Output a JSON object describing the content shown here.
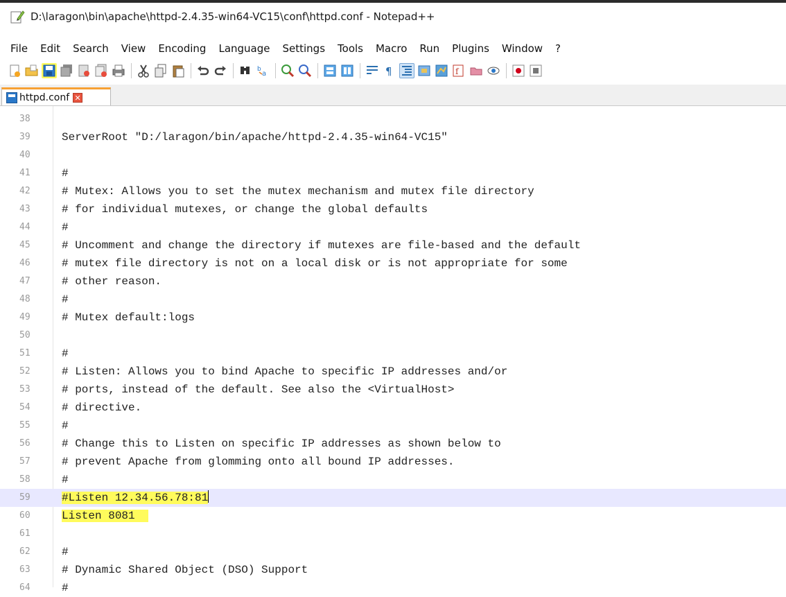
{
  "window": {
    "title": "D:\\laragon\\bin\\apache\\httpd-2.4.35-win64-VC15\\conf\\httpd.conf - Notepad++"
  },
  "menu": [
    {
      "label": "File",
      "name": "menu-file"
    },
    {
      "label": "Edit",
      "name": "menu-edit"
    },
    {
      "label": "Search",
      "name": "menu-search"
    },
    {
      "label": "View",
      "name": "menu-view"
    },
    {
      "label": "Encoding",
      "name": "menu-encoding"
    },
    {
      "label": "Language",
      "name": "menu-language"
    },
    {
      "label": "Settings",
      "name": "menu-settings"
    },
    {
      "label": "Tools",
      "name": "menu-tools"
    },
    {
      "label": "Macro",
      "name": "menu-macro"
    },
    {
      "label": "Run",
      "name": "menu-run"
    },
    {
      "label": "Plugins",
      "name": "menu-plugins"
    },
    {
      "label": "Window",
      "name": "menu-window"
    },
    {
      "label": "?",
      "name": "menu-help"
    }
  ],
  "tab": {
    "label": "httpd.conf",
    "close_glyph": "✕"
  },
  "editor": {
    "lines": [
      {
        "n": "38",
        "text": ""
      },
      {
        "n": "39",
        "text": "ServerRoot \"D:/laragon/bin/apache/httpd-2.4.35-win64-VC15\""
      },
      {
        "n": "40",
        "text": ""
      },
      {
        "n": "41",
        "text": "#"
      },
      {
        "n": "42",
        "text": "# Mutex: Allows you to set the mutex mechanism and mutex file directory"
      },
      {
        "n": "43",
        "text": "# for individual mutexes, or change the global defaults"
      },
      {
        "n": "44",
        "text": "#"
      },
      {
        "n": "45",
        "text": "# Uncomment and change the directory if mutexes are file-based and the default"
      },
      {
        "n": "46",
        "text": "# mutex file directory is not on a local disk or is not appropriate for some"
      },
      {
        "n": "47",
        "text": "# other reason."
      },
      {
        "n": "48",
        "text": "#"
      },
      {
        "n": "49",
        "text": "# Mutex default:logs"
      },
      {
        "n": "50",
        "text": ""
      },
      {
        "n": "51",
        "text": "#"
      },
      {
        "n": "52",
        "text": "# Listen: Allows you to bind Apache to specific IP addresses and/or"
      },
      {
        "n": "53",
        "text": "# ports, instead of the default. See also the <VirtualHost>"
      },
      {
        "n": "54",
        "text": "# directive."
      },
      {
        "n": "55",
        "text": "#"
      },
      {
        "n": "56",
        "text": "# Change this to Listen on specific IP addresses as shown below to"
      },
      {
        "n": "57",
        "text": "# prevent Apache from glomming onto all bound IP addresses."
      },
      {
        "n": "58",
        "text": "#"
      },
      {
        "n": "59",
        "text": "#Listen 12.34.56.78:81",
        "current": true,
        "highlight": true,
        "caret": true
      },
      {
        "n": "60",
        "text": "Listen 8081",
        "highlight": true
      },
      {
        "n": "61",
        "text": ""
      },
      {
        "n": "62",
        "text": "#"
      },
      {
        "n": "63",
        "text": "# Dynamic Shared Object (DSO) Support"
      },
      {
        "n": "64",
        "text": "#"
      }
    ]
  },
  "colors": {
    "highlight": "#fffb5c",
    "current_line": "#e8e8ff",
    "tab_accent": "#f7a033"
  }
}
